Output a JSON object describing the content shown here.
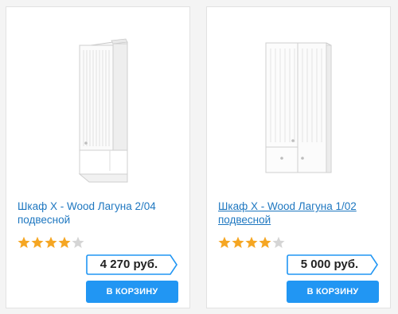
{
  "products": [
    {
      "name": "Шкаф X - Wood Лагуна 2/04 подвесной",
      "rating": 4,
      "rating_max": 5,
      "price": "4 270 руб.",
      "buy_label": "В КОРЗИНУ"
    },
    {
      "name": "Шкаф X - Wood Лагуна 1/02 подвесной",
      "rating": 4,
      "rating_max": 5,
      "price": "5 000 руб.",
      "buy_label": "В КОРЗИНУ"
    }
  ],
  "colors": {
    "link": "#1e77c0",
    "star_filled": "#f5a623",
    "star_empty": "#d5d5d5",
    "button": "#2196f3",
    "price_border": "#2196f3"
  }
}
